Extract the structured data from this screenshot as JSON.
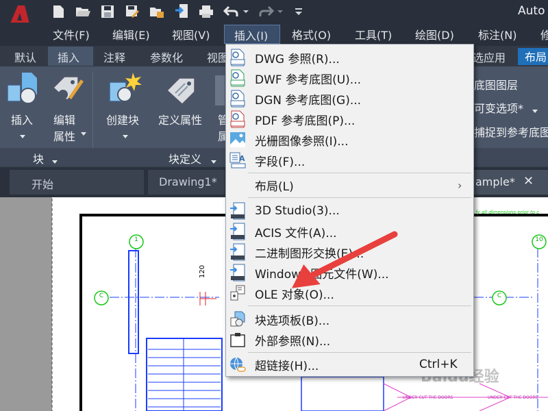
{
  "app": {
    "title": "Auto",
    "colors": {
      "accent": "#1f6fb9",
      "logo": "#c2262c",
      "menu_highlight": "#3a4d69",
      "annotation_arrow": "#e8403c"
    }
  },
  "quick_access": [
    "new-file-icon",
    "open-folder-icon",
    "save-icon",
    "save-as-icon",
    "open-web-icon",
    "export-icon",
    "print-icon",
    "undo-icon",
    "redo-icon",
    "customize-icon"
  ],
  "menubar": {
    "items": [
      "文件(F)",
      "编辑(E)",
      "视图(V)",
      "插入(I)",
      "格式(O)",
      "工具(T)",
      "绘图(D)",
      "标注(N)",
      "修"
    ],
    "active": "插入(I)"
  },
  "ribbon_tabs": {
    "items": [
      "默认",
      "插入",
      "注释",
      "参数化",
      "视图"
    ],
    "right_items": [
      "选应用",
      "布局"
    ],
    "active": "插入"
  },
  "ribbon": {
    "insert": "插入",
    "edit_attr_1": "编辑",
    "edit_attr_2": "属性",
    "create_block": "创建块",
    "define_attr": "定义属性",
    "manage_clip": "管",
    "manage_clip2": "属",
    "panel_block": "块",
    "panel_block_def": "块定义",
    "right_layer": "底图图层",
    "right_options": "可变选项*",
    "right_snap": "捕捉到参考底图"
  },
  "doc_tabs": {
    "start": "开始",
    "drawing1": "Drawing1*",
    "sample": "ample*"
  },
  "dropdown": {
    "items": [
      {
        "label": "DWG 参照(R)...",
        "icon": "dwg-icon"
      },
      {
        "label": "DWF 参考底图(U)...",
        "icon": "dwf-icon"
      },
      {
        "label": "DGN 参考底图(G)...",
        "icon": "dgn-icon"
      },
      {
        "label": "PDF 参考底图(P)...",
        "icon": "pdf-icon"
      },
      {
        "label": "光栅图像参照(I)...",
        "icon": "raster-image-icon"
      },
      {
        "label": "字段(F)...",
        "icon": "field-icon"
      },
      {
        "label": "布局(L)",
        "icon": ""
      },
      {
        "label": "3D Studio(3)...",
        "icon": "3ds-icon"
      },
      {
        "label": "ACIS 文件(A)...",
        "icon": "acis-icon"
      },
      {
        "label": "二进制图形交换(E)...",
        "icon": "xbin-icon"
      },
      {
        "label": "Windows 图元文件(W)...",
        "icon": "wmf-icon"
      },
      {
        "label": "OLE 对象(O)...",
        "icon": "ole-icon"
      },
      {
        "label": "块选项板(B)...",
        "icon": "block-palette-icon"
      },
      {
        "label": "外部参照(N)...",
        "icon": "xref-icon"
      },
      {
        "label": "超链接(H)...",
        "icon": "hyperlink-icon"
      }
    ],
    "hyperlink_shortcut": "Ctrl+K"
  },
  "drawing": {
    "grid_1": "1",
    "grid_c": "C",
    "grid_10": "10",
    "dim_120": "120",
    "note_top": "fy all dimensions prior to c",
    "under_cut_1": "UNDER CUT THE DOORS",
    "under_cut_2": "UNDER CUT THE DOORS"
  },
  "watermark": "Baidu经验"
}
